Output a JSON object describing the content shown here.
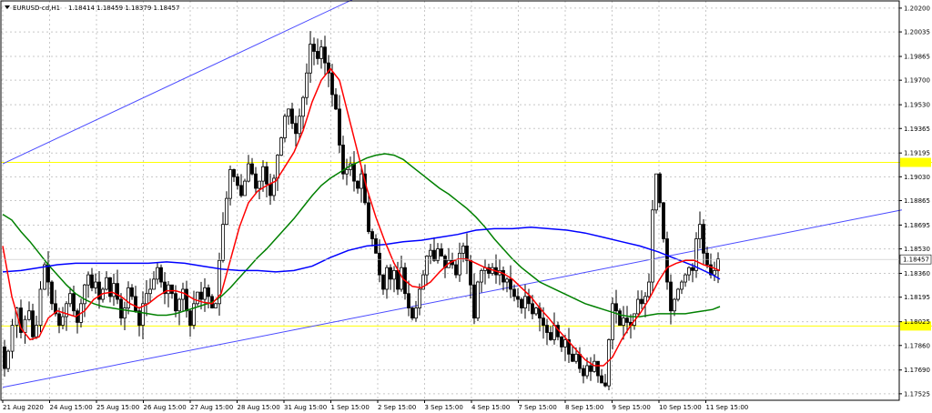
{
  "header": {
    "symbol": "EURUSD-cd,H1",
    "ohlc": "1.18414 1.18459 1.18379 1.18457"
  },
  "colors": {
    "ma_red": "#ff0000",
    "ma_green": "#008000",
    "ma_blue": "#0000ff",
    "channel": "#4a4aff",
    "levels": "#ffff00",
    "candles": "#000000",
    "grid": "#c8c8c8",
    "price_badge": "#ffffff"
  },
  "chart_data": {
    "type": "candlestick",
    "y_ticks": [
      "1.20200",
      "1.20035",
      "1.19865",
      "1.19700",
      "1.19530",
      "1.19365",
      "1.19195",
      "1.19030",
      "1.18865",
      "1.18695",
      "1.18530",
      "1.18360",
      "1.18195",
      "1.18025",
      "1.17860",
      "1.17690",
      "1.17525"
    ],
    "x_ticks": [
      "21 Aug 2020",
      "24 Aug 15:00",
      "25 Aug 15:00",
      "26 Aug 15:00",
      "27 Aug 15:00",
      "28 Aug 15:00",
      "31 Aug 15:00",
      "1 Sep 15:00",
      "2 Sep 15:00",
      "3 Sep 15:00",
      "4 Sep 15:00",
      "7 Sep 15:00",
      "8 Sep 15:00",
      "9 Sep 15:00",
      "10 Sep 15:00",
      "11 Sep 15:00"
    ],
    "ylim": [
      1.1748,
      1.2025
    ],
    "current_price": "1.18457",
    "horizontal_levels": [
      1.1913,
      1.17995
    ],
    "close_path": [
      [
        0,
        1.1785
      ],
      [
        4,
        1.177
      ],
      [
        8,
        1.1782
      ],
      [
        13,
        1.18
      ],
      [
        18,
        1.1812
      ],
      [
        22,
        1.1795
      ],
      [
        27,
        1.1804
      ],
      [
        31,
        1.181
      ],
      [
        35,
        1.1792
      ],
      [
        39,
        1.18
      ],
      [
        44,
        1.1825
      ],
      [
        48,
        1.1842
      ],
      [
        52,
        1.183
      ],
      [
        56,
        1.1815
      ],
      [
        60,
        1.1808
      ],
      [
        64,
        1.18
      ],
      [
        68,
        1.1806
      ],
      [
        72,
        1.1815
      ],
      [
        76,
        1.1822
      ],
      [
        80,
        1.181
      ],
      [
        84,
        1.1802
      ],
      [
        88,
        1.1815
      ],
      [
        92,
        1.1828
      ],
      [
        96,
        1.1835
      ],
      [
        100,
        1.1826
      ],
      [
        104,
        1.183
      ],
      [
        108,
        1.1818
      ],
      [
        112,
        1.1825
      ],
      [
        116,
        1.1833
      ],
      [
        120,
        1.182
      ],
      [
        124,
        1.1829
      ],
      [
        128,
        1.1818
      ],
      [
        132,
        1.1805
      ],
      [
        136,
        1.1812
      ],
      [
        140,
        1.1826
      ],
      [
        144,
        1.182
      ],
      [
        148,
        1.181
      ],
      [
        152,
        1.18
      ],
      [
        156,
        1.1815
      ],
      [
        160,
        1.1822
      ],
      [
        164,
        1.1825
      ],
      [
        168,
        1.1832
      ],
      [
        172,
        1.184
      ],
      [
        176,
        1.183
      ],
      [
        180,
        1.1822
      ],
      [
        184,
        1.1828
      ],
      [
        188,
        1.1822
      ],
      [
        192,
        1.181
      ],
      [
        196,
        1.1818
      ],
      [
        200,
        1.1825
      ],
      [
        204,
        1.181
      ],
      [
        208,
        1.18
      ],
      [
        212,
        1.1815
      ],
      [
        216,
        1.1823
      ],
      [
        220,
        1.1818
      ],
      [
        224,
        1.1826
      ],
      [
        228,
        1.182
      ],
      [
        232,
        1.1812
      ],
      [
        236,
        1.1815
      ],
      [
        240,
        1.1845
      ],
      [
        244,
        1.187
      ],
      [
        248,
        1.1888
      ],
      [
        252,
        1.1908
      ],
      [
        256,
        1.1903
      ],
      [
        260,
        1.1897
      ],
      [
        264,
        1.189
      ],
      [
        268,
        1.19
      ],
      [
        272,
        1.1912
      ],
      [
        276,
        1.1905
      ],
      [
        280,
        1.1895
      ],
      [
        284,
        1.19
      ],
      [
        288,
        1.191
      ],
      [
        292,
        1.1898
      ],
      [
        296,
        1.189
      ],
      [
        300,
        1.1902
      ],
      [
        304,
        1.1918
      ],
      [
        308,
        1.193
      ],
      [
        312,
        1.1945
      ],
      [
        316,
        1.195
      ],
      [
        320,
        1.194
      ],
      [
        324,
        1.1933
      ],
      [
        328,
        1.1945
      ],
      [
        332,
        1.1958
      ],
      [
        336,
        1.1975
      ],
      [
        340,
        1.1995
      ],
      [
        344,
        1.199
      ],
      [
        348,
        1.1985
      ],
      [
        352,
        1.1993
      ],
      [
        356,
        1.1982
      ],
      [
        360,
        1.1975
      ],
      [
        364,
        1.196
      ],
      [
        368,
        1.195
      ],
      [
        372,
        1.1925
      ],
      [
        376,
        1.1905
      ],
      [
        380,
        1.1908
      ],
      [
        384,
        1.1912
      ],
      [
        388,
        1.19
      ],
      [
        392,
        1.1895
      ],
      [
        396,
        1.1905
      ],
      [
        400,
        1.1885
      ],
      [
        404,
        1.1865
      ],
      [
        408,
        1.186
      ],
      [
        412,
        1.185
      ],
      [
        416,
        1.1835
      ],
      [
        420,
        1.1825
      ],
      [
        424,
        1.184
      ],
      [
        428,
        1.1832
      ],
      [
        432,
        1.1838
      ],
      [
        436,
        1.1825
      ],
      [
        440,
        1.184
      ],
      [
        444,
        1.1822
      ],
      [
        448,
        1.1812
      ],
      [
        452,
        1.1805
      ],
      [
        456,
        1.1812
      ],
      [
        460,
        1.1825
      ],
      [
        464,
        1.1835
      ],
      [
        468,
        1.1848
      ],
      [
        472,
        1.1852
      ],
      [
        476,
        1.1845
      ],
      [
        480,
        1.1853
      ],
      [
        484,
        1.1848
      ],
      [
        488,
        1.184
      ],
      [
        492,
        1.1845
      ],
      [
        496,
        1.1842
      ],
      [
        500,
        1.1835
      ],
      [
        504,
        1.185
      ],
      [
        508,
        1.1855
      ],
      [
        512,
        1.1845
      ],
      [
        516,
        1.1828
      ],
      [
        520,
        1.1805
      ],
      [
        524,
        1.183
      ],
      [
        528,
        1.1838
      ],
      [
        532,
        1.184
      ],
      [
        536,
        1.1836
      ],
      [
        540,
        1.184
      ],
      [
        544,
        1.1835
      ],
      [
        548,
        1.1838
      ],
      [
        552,
        1.183
      ],
      [
        556,
        1.1832
      ],
      [
        560,
        1.1825
      ],
      [
        564,
        1.182
      ],
      [
        568,
        1.1818
      ],
      [
        572,
        1.1812
      ],
      [
        576,
        1.182
      ],
      [
        580,
        1.1815
      ],
      [
        584,
        1.1808
      ],
      [
        588,
        1.1812
      ],
      [
        592,
        1.1805
      ],
      [
        596,
        1.18
      ],
      [
        600,
        1.1795
      ],
      [
        604,
        1.179
      ],
      [
        608,
        1.18
      ],
      [
        612,
        1.1792
      ],
      [
        616,
        1.1785
      ],
      [
        620,
        1.179
      ],
      [
        624,
        1.178
      ],
      [
        628,
        1.1775
      ],
      [
        632,
        1.178
      ],
      [
        636,
        1.177
      ],
      [
        640,
        1.1765
      ],
      [
        644,
        1.1772
      ],
      [
        648,
        1.1768
      ],
      [
        652,
        1.1775
      ],
      [
        656,
        1.1765
      ],
      [
        660,
        1.176
      ],
      [
        664,
        1.1758
      ],
      [
        668,
        1.179
      ],
      [
        672,
        1.1815
      ],
      [
        676,
        1.181
      ],
      [
        680,
        1.18
      ],
      [
        684,
        1.1805
      ],
      [
        688,
        1.1802
      ],
      [
        692,
        1.18
      ],
      [
        696,
        1.1808
      ],
      [
        700,
        1.1818
      ],
      [
        704,
        1.1815
      ],
      [
        708,
        1.182
      ],
      [
        712,
        1.183
      ],
      [
        716,
        1.188
      ],
      [
        720,
        1.1905
      ],
      [
        724,
        1.1885
      ],
      [
        728,
        1.186
      ],
      [
        732,
        1.183
      ],
      [
        736,
        1.181
      ],
      [
        740,
        1.1818
      ],
      [
        744,
        1.1825
      ],
      [
        748,
        1.183
      ],
      [
        752,
        1.1835
      ],
      [
        756,
        1.184
      ],
      [
        760,
        1.1838
      ],
      [
        764,
        1.186
      ],
      [
        768,
        1.187
      ],
      [
        772,
        1.185
      ],
      [
        776,
        1.1842
      ],
      [
        780,
        1.1835
      ],
      [
        784,
        1.1838
      ],
      [
        788,
        1.1846
      ]
    ],
    "ma_red": [
      [
        0,
        1.1855
      ],
      [
        10,
        1.182
      ],
      [
        20,
        1.1798
      ],
      [
        30,
        1.179
      ],
      [
        40,
        1.1792
      ],
      [
        50,
        1.1805
      ],
      [
        60,
        1.181
      ],
      [
        70,
        1.1808
      ],
      [
        80,
        1.1806
      ],
      [
        90,
        1.181
      ],
      [
        100,
        1.1818
      ],
      [
        110,
        1.1822
      ],
      [
        120,
        1.1823
      ],
      [
        130,
        1.182
      ],
      [
        140,
        1.1815
      ],
      [
        150,
        1.1812
      ],
      [
        160,
        1.1815
      ],
      [
        170,
        1.182
      ],
      [
        180,
        1.1824
      ],
      [
        190,
        1.1824
      ],
      [
        200,
        1.1822
      ],
      [
        210,
        1.1818
      ],
      [
        220,
        1.1816
      ],
      [
        230,
        1.1815
      ],
      [
        240,
        1.1822
      ],
      [
        250,
        1.1845
      ],
      [
        260,
        1.1868
      ],
      [
        270,
        1.1885
      ],
      [
        280,
        1.1893
      ],
      [
        290,
        1.1897
      ],
      [
        300,
        1.19
      ],
      [
        310,
        1.191
      ],
      [
        320,
        1.192
      ],
      [
        330,
        1.1935
      ],
      [
        340,
        1.1955
      ],
      [
        350,
        1.197
      ],
      [
        360,
        1.1978
      ],
      [
        370,
        1.197
      ],
      [
        380,
        1.1945
      ],
      [
        390,
        1.192
      ],
      [
        400,
        1.1895
      ],
      [
        410,
        1.1875
      ],
      [
        420,
        1.1858
      ],
      [
        430,
        1.1843
      ],
      [
        440,
        1.1832
      ],
      [
        450,
        1.1827
      ],
      [
        460,
        1.1826
      ],
      [
        470,
        1.183
      ],
      [
        480,
        1.1837
      ],
      [
        490,
        1.1843
      ],
      [
        500,
        1.1846
      ],
      [
        510,
        1.1846
      ],
      [
        520,
        1.1843
      ],
      [
        530,
        1.184
      ],
      [
        540,
        1.1838
      ],
      [
        550,
        1.1836
      ],
      [
        560,
        1.1832
      ],
      [
        570,
        1.1826
      ],
      [
        580,
        1.182
      ],
      [
        590,
        1.1812
      ],
      [
        600,
        1.1805
      ],
      [
        610,
        1.1797
      ],
      [
        620,
        1.179
      ],
      [
        630,
        1.1783
      ],
      [
        640,
        1.1776
      ],
      [
        650,
        1.1772
      ],
      [
        660,
        1.1772
      ],
      [
        670,
        1.1778
      ],
      [
        680,
        1.179
      ],
      [
        690,
        1.18
      ],
      [
        700,
        1.1808
      ],
      [
        710,
        1.1818
      ],
      [
        720,
        1.183
      ],
      [
        730,
        1.184
      ],
      [
        740,
        1.1843
      ],
      [
        750,
        1.1845
      ],
      [
        760,
        1.1845
      ],
      [
        770,
        1.1842
      ],
      [
        780,
        1.184
      ],
      [
        788,
        1.1838
      ]
    ],
    "ma_green": [
      [
        0,
        1.1877
      ],
      [
        10,
        1.1873
      ],
      [
        20,
        1.1865
      ],
      [
        30,
        1.1858
      ],
      [
        40,
        1.185
      ],
      [
        50,
        1.1842
      ],
      [
        60,
        1.1835
      ],
      [
        70,
        1.1828
      ],
      [
        80,
        1.1822
      ],
      [
        90,
        1.1818
      ],
      [
        100,
        1.1815
      ],
      [
        110,
        1.1813
      ],
      [
        120,
        1.1812
      ],
      [
        130,
        1.1811
      ],
      [
        140,
        1.181
      ],
      [
        150,
        1.1809
      ],
      [
        160,
        1.1808
      ],
      [
        170,
        1.1807
      ],
      [
        180,
        1.1807
      ],
      [
        190,
        1.1808
      ],
      [
        200,
        1.181
      ],
      [
        210,
        1.1812
      ],
      [
        220,
        1.1814
      ],
      [
        230,
        1.1816
      ],
      [
        240,
        1.182
      ],
      [
        250,
        1.1826
      ],
      [
        260,
        1.1833
      ],
      [
        270,
        1.184
      ],
      [
        280,
        1.1847
      ],
      [
        290,
        1.1853
      ],
      [
        300,
        1.186
      ],
      [
        310,
        1.1867
      ],
      [
        320,
        1.1874
      ],
      [
        330,
        1.1882
      ],
      [
        340,
        1.189
      ],
      [
        350,
        1.1897
      ],
      [
        360,
        1.1902
      ],
      [
        370,
        1.1906
      ],
      [
        380,
        1.191
      ],
      [
        390,
        1.1913
      ],
      [
        400,
        1.1916
      ],
      [
        410,
        1.1918
      ],
      [
        420,
        1.1919
      ],
      [
        430,
        1.1918
      ],
      [
        440,
        1.1915
      ],
      [
        450,
        1.191
      ],
      [
        460,
        1.1905
      ],
      [
        470,
        1.19
      ],
      [
        480,
        1.1895
      ],
      [
        490,
        1.1891
      ],
      [
        500,
        1.1886
      ],
      [
        510,
        1.1881
      ],
      [
        520,
        1.1875
      ],
      [
        530,
        1.1868
      ],
      [
        540,
        1.186
      ],
      [
        550,
        1.1853
      ],
      [
        560,
        1.1846
      ],
      [
        570,
        1.184
      ],
      [
        580,
        1.1835
      ],
      [
        590,
        1.183
      ],
      [
        600,
        1.1827
      ],
      [
        610,
        1.1824
      ],
      [
        620,
        1.1821
      ],
      [
        630,
        1.1818
      ],
      [
        640,
        1.1815
      ],
      [
        650,
        1.1813
      ],
      [
        660,
        1.1811
      ],
      [
        670,
        1.1809
      ],
      [
        680,
        1.1807
      ],
      [
        690,
        1.1806
      ],
      [
        700,
        1.1806
      ],
      [
        710,
        1.1807
      ],
      [
        720,
        1.1808
      ],
      [
        730,
        1.1808
      ],
      [
        740,
        1.1808
      ],
      [
        750,
        1.1808
      ],
      [
        760,
        1.1809
      ],
      [
        770,
        1.181
      ],
      [
        780,
        1.1811
      ],
      [
        788,
        1.1813
      ]
    ],
    "ma_blue": [
      [
        0,
        1.1837
      ],
      [
        20,
        1.1838
      ],
      [
        40,
        1.184
      ],
      [
        60,
        1.1842
      ],
      [
        80,
        1.1843
      ],
      [
        100,
        1.1843
      ],
      [
        120,
        1.1843
      ],
      [
        140,
        1.1843
      ],
      [
        160,
        1.1843
      ],
      [
        180,
        1.1844
      ],
      [
        200,
        1.1843
      ],
      [
        220,
        1.1841
      ],
      [
        240,
        1.1839
      ],
      [
        260,
        1.1838
      ],
      [
        280,
        1.1838
      ],
      [
        300,
        1.1837
      ],
      [
        320,
        1.1838
      ],
      [
        340,
        1.1841
      ],
      [
        360,
        1.1847
      ],
      [
        380,
        1.1852
      ],
      [
        400,
        1.1855
      ],
      [
        420,
        1.1856
      ],
      [
        440,
        1.1858
      ],
      [
        460,
        1.1859
      ],
      [
        480,
        1.1861
      ],
      [
        500,
        1.1863
      ],
      [
        520,
        1.1866
      ],
      [
        540,
        1.1867
      ],
      [
        560,
        1.1867
      ],
      [
        580,
        1.1868
      ],
      [
        600,
        1.1867
      ],
      [
        620,
        1.1866
      ],
      [
        640,
        1.1864
      ],
      [
        660,
        1.1861
      ],
      [
        680,
        1.1858
      ],
      [
        700,
        1.1855
      ],
      [
        720,
        1.1851
      ],
      [
        740,
        1.1846
      ],
      [
        760,
        1.1841
      ],
      [
        780,
        1.1835
      ],
      [
        788,
        1.1832
      ]
    ],
    "channel_upper": [
      [
        0,
        1.1912
      ],
      [
        398,
        1.203
      ]
    ],
    "channel_lower": [
      [
        0,
        1.1757
      ],
      [
        988,
        1.188
      ]
    ]
  }
}
